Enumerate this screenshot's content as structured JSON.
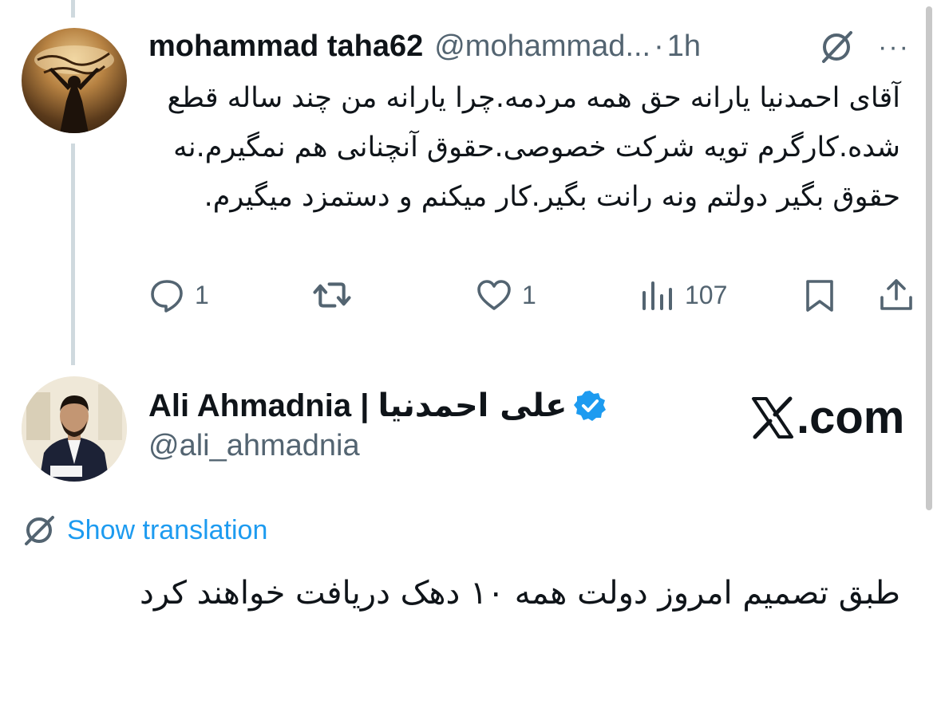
{
  "reply": {
    "display_name": "mohammad taha62",
    "handle": "@mohammad...",
    "separator": "·",
    "time": "1h",
    "more_label": "···",
    "text": "آقای احمدنیا یارانه حق همه مردمه.چرا یارانه من چند ساله قطع شده.کارگرم تویه شرکت خصوصی.حقوق آنچنانی هم نمگیرم.نه حقوق بگیر دولتم ونه رانت بگیر.کار میکنم و دستمزد میگیرم.",
    "actions": {
      "reply_count": "1",
      "like_count": "1",
      "views_count": "107"
    }
  },
  "original": {
    "display_name_latin": "Ali Ahmadnia | ",
    "display_name_persian": "علی احمدنیا",
    "handle": "@ali_ahmadnia",
    "site_label": ".com",
    "show_translation": "Show translation",
    "text": "طبق تصمیم امروز دولت همه ۱۰ دهک دریافت خواهند کرد"
  },
  "colors": {
    "accent": "#1d9bf0",
    "secondary_text": "#536471",
    "primary_text": "#0f1419",
    "thread_line": "#cfd9de"
  },
  "icons": {
    "grok": "grok-slash-icon",
    "more": "more-dots-icon",
    "reply": "reply-bubble-icon",
    "retweet": "retweet-icon",
    "like": "heart-icon",
    "views": "views-bar-icon",
    "bookmark": "bookmark-icon",
    "share": "share-icon",
    "verified": "verified-badge-icon",
    "x_logo": "x-logo-icon",
    "translate": "translate-icon"
  }
}
